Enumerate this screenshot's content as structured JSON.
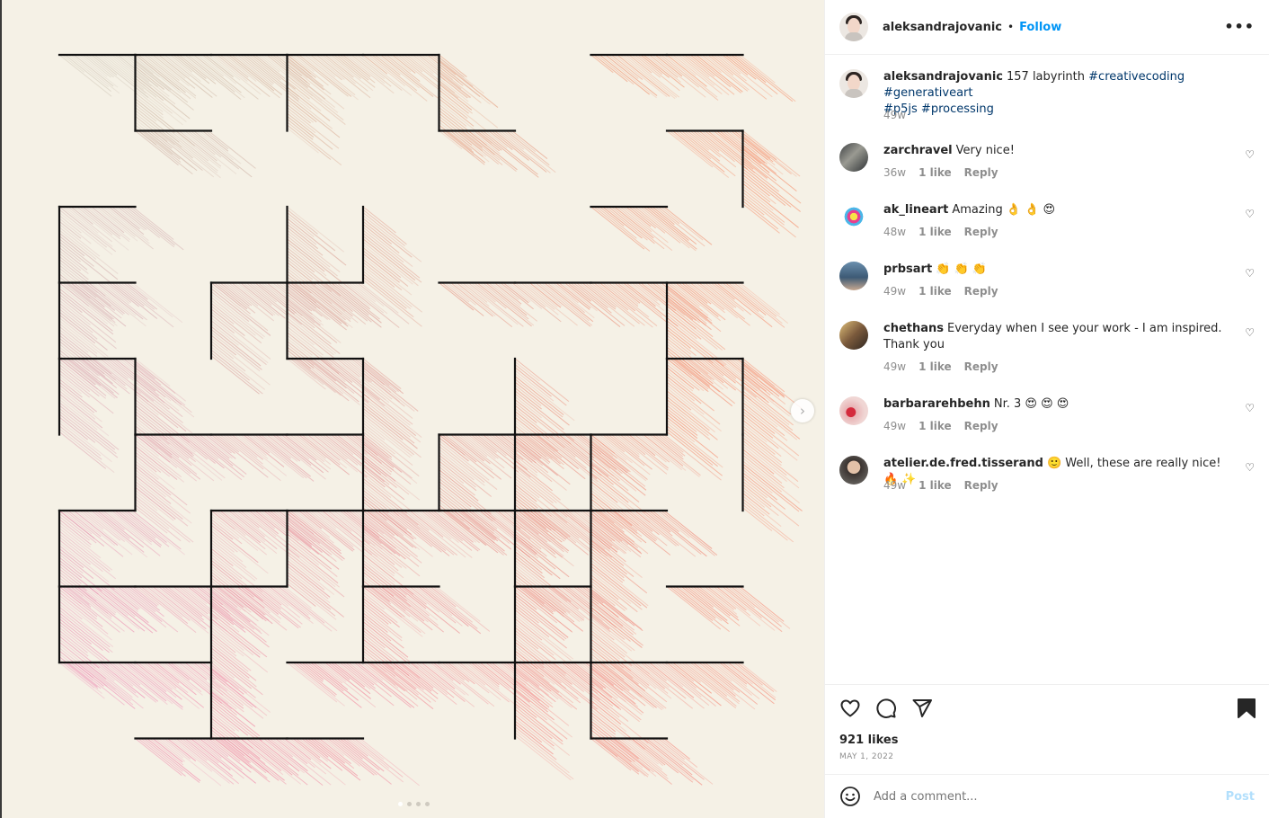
{
  "post": {
    "username": "aleksandrajovanic",
    "separator": "•",
    "follow_label": "Follow",
    "more_label": "•••",
    "caption_user": "aleksandrajovanic",
    "caption_text": "157 labyrinth",
    "hashtags_line1": "#creativecoding #generativeart",
    "hashtags_line2": "#p5js #processing",
    "caption_time": "49w",
    "likes": "921 likes",
    "date": "MAY 1, 2022",
    "comment_placeholder": "Add a comment...",
    "post_label": "Post"
  },
  "comments": [
    {
      "user": "zarchravel",
      "text": "Very nice!",
      "time": "36w",
      "likes": "1 like",
      "reply": "Reply"
    },
    {
      "user": "ak_lineart",
      "text": "Amazing 👌 👌 😍",
      "time": "48w",
      "likes": "1 like",
      "reply": "Reply"
    },
    {
      "user": "prbsart",
      "text": "👏 👏 👏",
      "time": "49w",
      "likes": "1 like",
      "reply": "Reply"
    },
    {
      "user": "chethans",
      "text": "Everyday when I see your work - I am inspired. Thank you",
      "time": "49w",
      "likes": "1 like",
      "reply": "Reply"
    },
    {
      "user": "barbararehbehn",
      "text": "Nr. 3 😍 😍 😍",
      "time": "49w",
      "likes": "1 like",
      "reply": "Reply"
    },
    {
      "user": "atelier.de.fred.tisserand",
      "text": "🙂 Well, these are really nice! 🔥 ✨",
      "time": "49w",
      "likes": "1 like",
      "reply": "Reply"
    }
  ],
  "carousel": {
    "count": 4,
    "active": 0
  },
  "colors": {
    "accent": "#0095f6",
    "background": "#f5f1e6",
    "wall": "#111111"
  },
  "icons": [
    "chevron-right-icon",
    "more-icon",
    "heart-icon",
    "comment-icon",
    "share-icon",
    "bookmark-icon",
    "emoji-icon"
  ]
}
